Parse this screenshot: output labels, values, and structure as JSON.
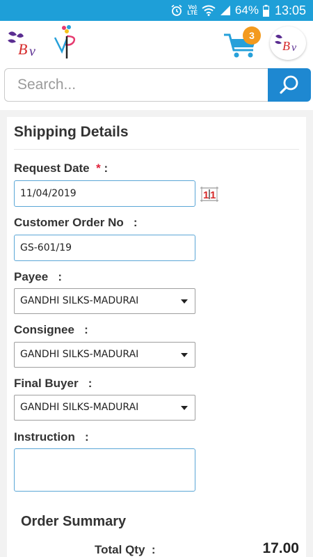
{
  "status_bar": {
    "battery_percent": "64%",
    "time": "13:05",
    "network_label_top": "Vo)",
    "network_label_bottom": "LTE",
    "icons": [
      "alarm-icon",
      "volte-icon",
      "wifi-icon",
      "signal-icon",
      "battery-icon"
    ],
    "background_color": "#1e9fd8"
  },
  "header": {
    "cart_count": "3",
    "brand_logo_left": "BV",
    "brand_logo_right": "BV",
    "icons": [
      "bv-logo",
      "vp-logo",
      "cart-icon",
      "bv-logo-round"
    ],
    "badge_color": "#f39a1e"
  },
  "search": {
    "placeholder": "Search...",
    "value": "",
    "button_icon": "search-icon",
    "button_color": "#1e88d1"
  },
  "shipping": {
    "title": "Shipping Details",
    "request_date_label": "Request Date",
    "required_mark": "*",
    "label_colon": " :",
    "request_date_value": "11/04/2019",
    "calendar_icon": "calendar-icon",
    "customer_order_label": "Customer Order No   :",
    "customer_order_value": "GS-601/19",
    "payee_label": "Payee   :",
    "payee_value": "GANDHI SILKS-MADURAI",
    "consignee_label": "Consignee   :",
    "consignee_value": "GANDHI SILKS-MADURAI",
    "final_buyer_label": "Final Buyer   :",
    "final_buyer_value": "GANDHI SILKS-MADURAI",
    "instruction_label": "Instruction   :",
    "instruction_value": ""
  },
  "summary": {
    "title": "Order Summary",
    "total_qty_label": "Total Qty  :",
    "total_qty_value": "17.00"
  }
}
